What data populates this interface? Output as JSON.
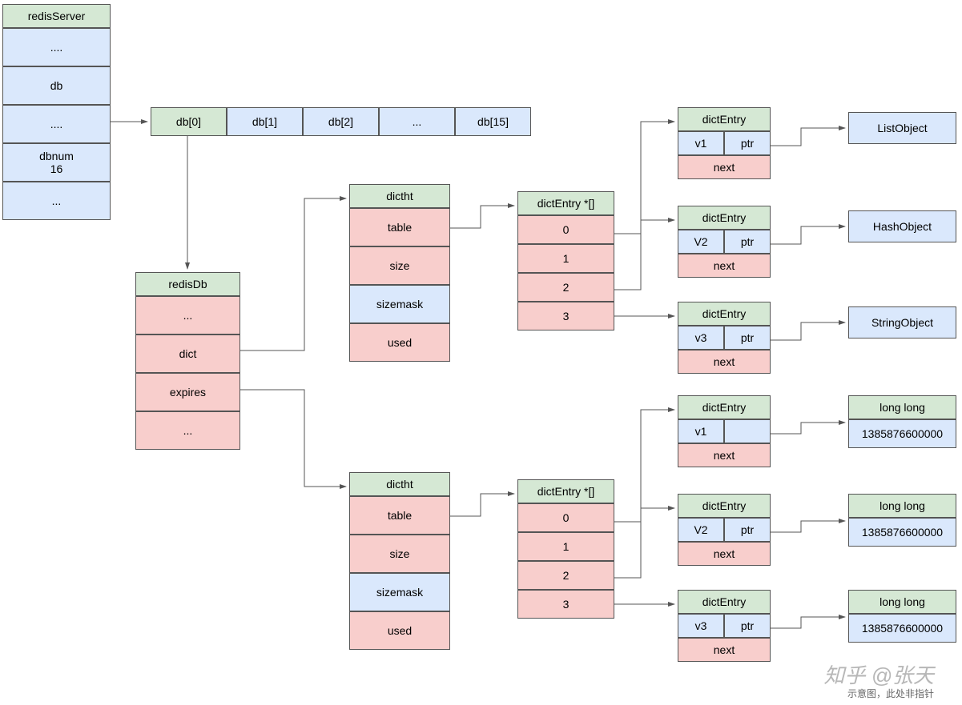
{
  "redisServer": {
    "header": "redisServer",
    "rows": [
      "....",
      "db",
      "....",
      "dbnum\n16",
      "..."
    ]
  },
  "dbArray": [
    "db[0]",
    "db[1]",
    "db[2]",
    "...",
    "db[15]"
  ],
  "redisDb": {
    "header": "redisDb",
    "rows": [
      "...",
      "dict",
      "expires",
      "..."
    ]
  },
  "dictht1": {
    "header": "dictht",
    "rows": [
      "table",
      "size",
      "sizemask",
      "used"
    ]
  },
  "dictht2": {
    "header": "dictht",
    "rows": [
      "table",
      "size",
      "sizemask",
      "used"
    ]
  },
  "dictEntryArr1": {
    "header": "dictEntry *[]",
    "rows": [
      "0",
      "1",
      "2",
      "3"
    ]
  },
  "dictEntryArr2": {
    "header": "dictEntry *[]",
    "rows": [
      "0",
      "1",
      "2",
      "3"
    ]
  },
  "entries1": [
    {
      "header": "dictEntry",
      "v": "v1",
      "p": "ptr",
      "next": "next",
      "obj": "ListObject"
    },
    {
      "header": "dictEntry",
      "v": "V2",
      "p": "ptr",
      "next": "next",
      "obj": "HashObject"
    },
    {
      "header": "dictEntry",
      "v": "v3",
      "p": "ptr",
      "next": "next",
      "obj": "StringObject"
    }
  ],
  "entries2": [
    {
      "header": "dictEntry",
      "v": "v1",
      "p": "",
      "next": "next",
      "objH": "long long",
      "objV": "1385876600000"
    },
    {
      "header": "dictEntry",
      "v": "V2",
      "p": "ptr",
      "next": "next",
      "objH": "long long",
      "objV": "1385876600000"
    },
    {
      "header": "dictEntry",
      "v": "v3",
      "p": "ptr",
      "next": "next",
      "objH": "long long",
      "objV": "1385876600000"
    }
  ],
  "watermark": "知乎 @张天",
  "caption": "示意图，此处非指针"
}
